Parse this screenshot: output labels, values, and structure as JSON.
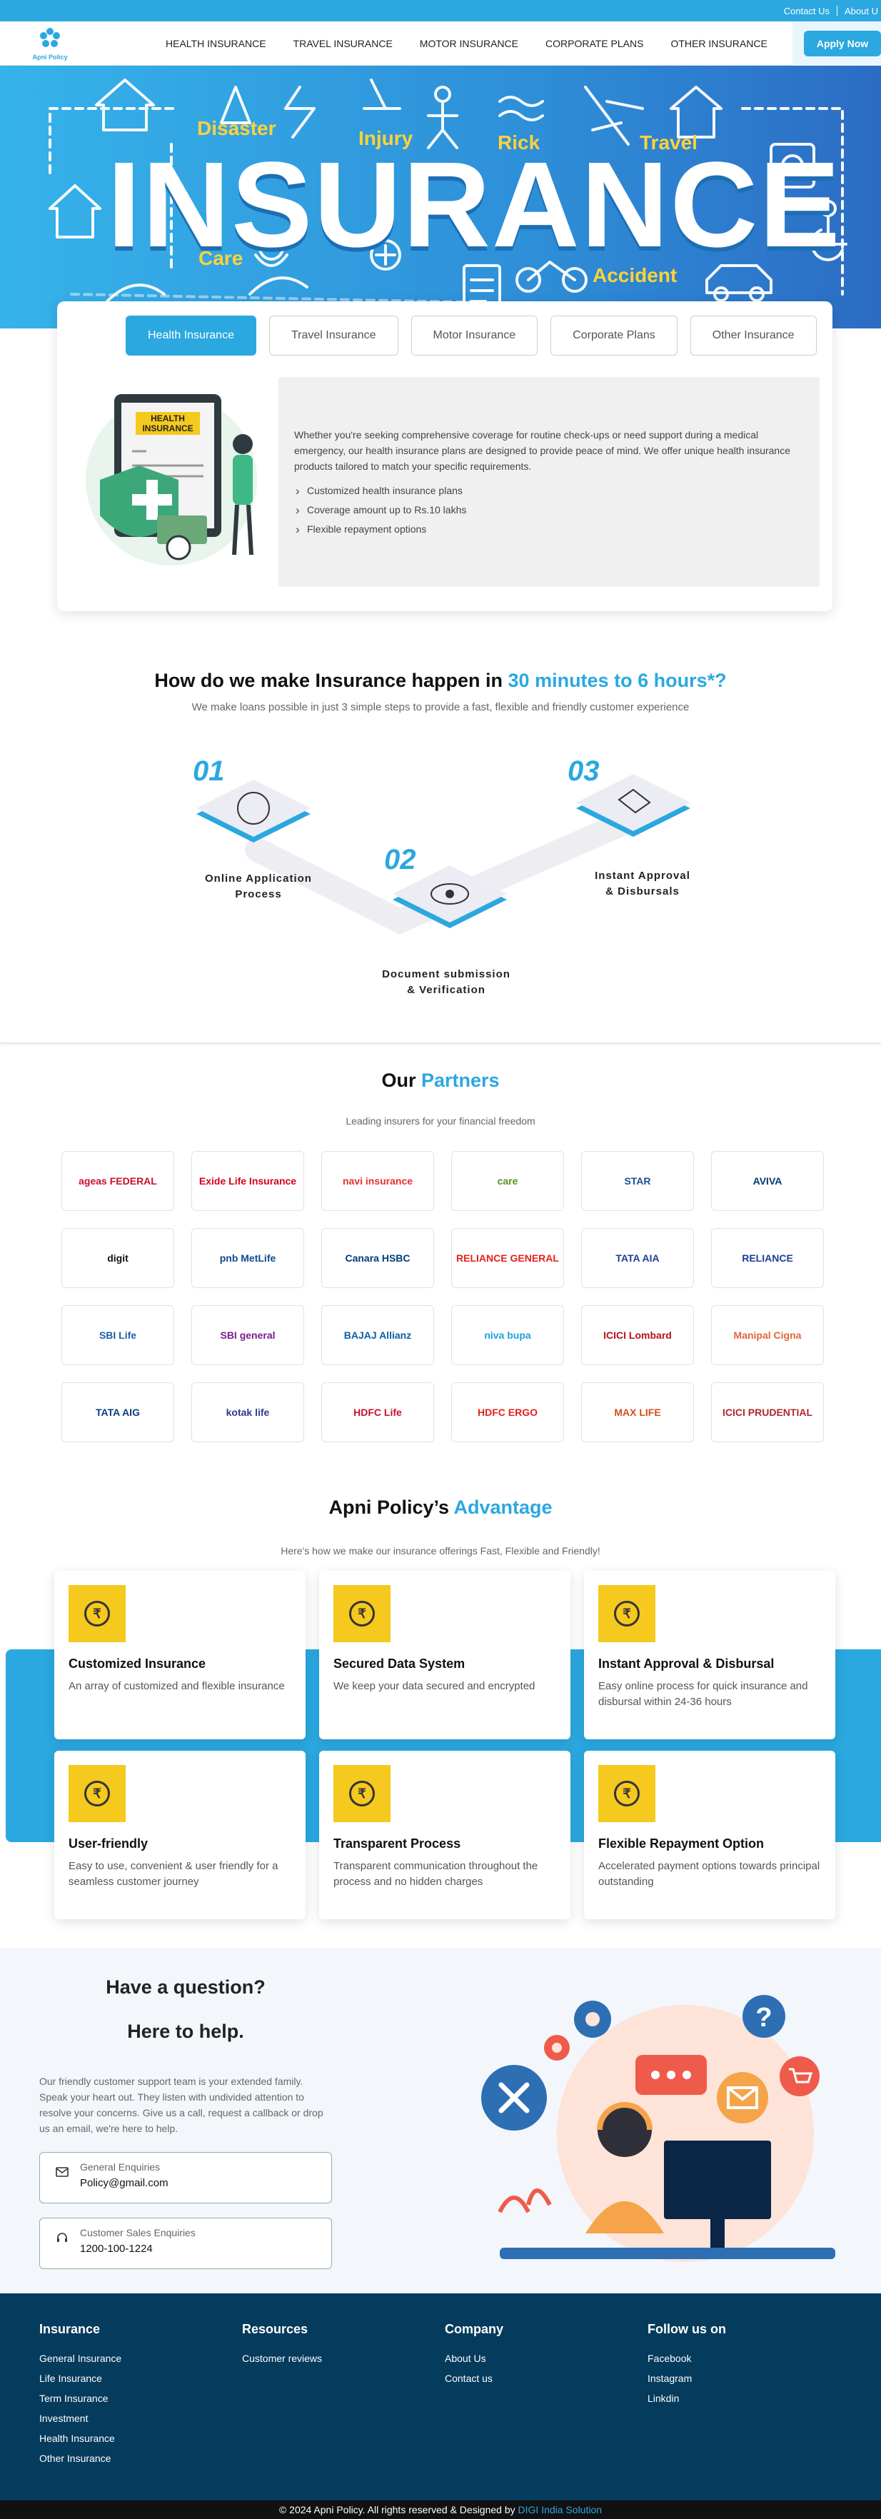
{
  "topbar": {
    "contact": "Contact Us",
    "about": "About U"
  },
  "nav": {
    "logo_text": "Apni Policy",
    "items": [
      "HEALTH INSURANCE",
      "TRAVEL INSURANCE",
      "MOTOR INSURANCE",
      "CORPORATE PLANS",
      "OTHER INSURANCE"
    ],
    "apply": "Apply Now"
  },
  "hero": {
    "title": "INSURANCE",
    "keywords": [
      "Disaster",
      "Injury",
      "Rick",
      "Travel",
      "Care",
      "Accident"
    ]
  },
  "tabs": {
    "items": [
      "Health Insurance",
      "Travel Insurance",
      "Motor Insurance",
      "Corporate Plans",
      "Other Insurance"
    ],
    "illus_label": "HEALTH INSURANCE",
    "description": "Whether you're seeking comprehensive coverage for routine check-ups or need support during a medical emergency, our health insurance plans are designed to provide peace of mind. We offer unique health insurance products tailored to match your specific requirements.",
    "bullets": [
      "Customized health insurance plans",
      "Coverage amount up to Rs.10 lakhs",
      "Flexible repayment options"
    ]
  },
  "steps": {
    "title_prefix": "How do we make Insurance happen in ",
    "title_highlight": "30 minutes to 6 hours*?",
    "subtitle": "We make loans possible in just 3 simple steps to provide a fast, flexible and friendly customer experience",
    "items": [
      {
        "num": "01",
        "line1": "Online Application",
        "line2": "Process"
      },
      {
        "num": "02",
        "line1": "Document submission",
        "line2": "& Verification"
      },
      {
        "num": "03",
        "line1": "Instant Approval",
        "line2": "& Disbursals"
      }
    ]
  },
  "partners": {
    "title_prefix": "Our ",
    "title_highlight": "Partners",
    "subtitle": "Leading insurers for your financial freedom",
    "logos": [
      "ageas FEDERAL",
      "Exide Life Insurance",
      "navi insurance",
      "care",
      "STAR",
      "AVIVA",
      "digit",
      "pnb MetLife",
      "Canara HSBC",
      "RELIANCE GENERAL",
      "TATA AIA",
      "RELIANCE",
      "SBI Life",
      "SBI general",
      "BAJAJ Allianz",
      "niva bupa",
      "ICICI Lombard",
      "Manipal Cigna",
      "TATA AIG",
      "kotak life",
      "HDFC Life",
      "HDFC ERGO",
      "MAX LIFE",
      "ICICI PRUDENTIAL"
    ],
    "logo_colors": [
      "#c8102e",
      "#d6001c",
      "#e5322d",
      "#5b8f1f",
      "#1d4f91",
      "#003a70",
      "#111111",
      "#0d4a8f",
      "#003b7a",
      "#e2231a",
      "#1c3f94",
      "#1c3f94",
      "#1f5ea8",
      "#7a1e8c",
      "#0b5fa5",
      "#1fa2dc",
      "#b5121b",
      "#e2663a",
      "#0a3f7a",
      "#2a3a8f",
      "#c8102e",
      "#e2231a",
      "#d1501a",
      "#ae282e"
    ],
    "color_label": "#2ba8e0"
  },
  "advantage": {
    "title_prefix": "Apni Policy’s ",
    "title_highlight": "Advantage",
    "subtitle": "Here's how we make our insurance offerings Fast, Flexible and Friendly!",
    "items": [
      {
        "title": "Customized Insurance",
        "text": "An array of customized and flexible insurance"
      },
      {
        "title": "Secured Data System",
        "text": "We keep your data secured and encrypted"
      },
      {
        "title": "Instant Approval & Disbursal",
        "text": "Easy online process for quick insurance and disbursal within 24-36 hours"
      },
      {
        "title": "User-friendly",
        "text": "Easy to use, convenient & user friendly for a seamless customer journey"
      },
      {
        "title": "Transparent Process",
        "text": "Transparent communication throughout the process and no hidden charges"
      },
      {
        "title": "Flexible Repayment Option",
        "text": "Accelerated payment options towards principal outstanding"
      }
    ],
    "icon_glyph": "₹"
  },
  "help": {
    "title1": "Have a question?",
    "title2": "Here to help.",
    "text": "Our friendly customer support team is your extended family. Speak your heart out. They listen with undivided attention to resolve your concerns. Give us a call, request a callback or drop us an email, we're here to help.",
    "email_label": "General Enquiries",
    "email": "Policy@gmail.com",
    "phone_label": "Customer Sales Enquiries",
    "phone": "1200-100-1224"
  },
  "footer": {
    "cols": [
      {
        "title": "Insurance",
        "links": [
          "General Insurance",
          "Life Insurance",
          "Term Insurance",
          "Investment",
          "Health Insurance",
          "Other Insurance"
        ]
      },
      {
        "title": "Resources",
        "links": [
          "Customer reviews"
        ]
      },
      {
        "title": "Company",
        "links": [
          "About Us",
          "Contact us"
        ]
      },
      {
        "title": "Follow us on",
        "links": [
          "Facebook",
          "Instagram",
          "Linkdin"
        ]
      }
    ],
    "copyright": "© 2024 Apni Policy. All rights reserved & Designed by ",
    "designer": "DIGI India Solution"
  },
  "colors": {
    "primary": "#2ba8e0",
    "footer": "#053b5c",
    "icon_bg": "#f5c91d",
    "keyword": "#ffd23a"
  }
}
